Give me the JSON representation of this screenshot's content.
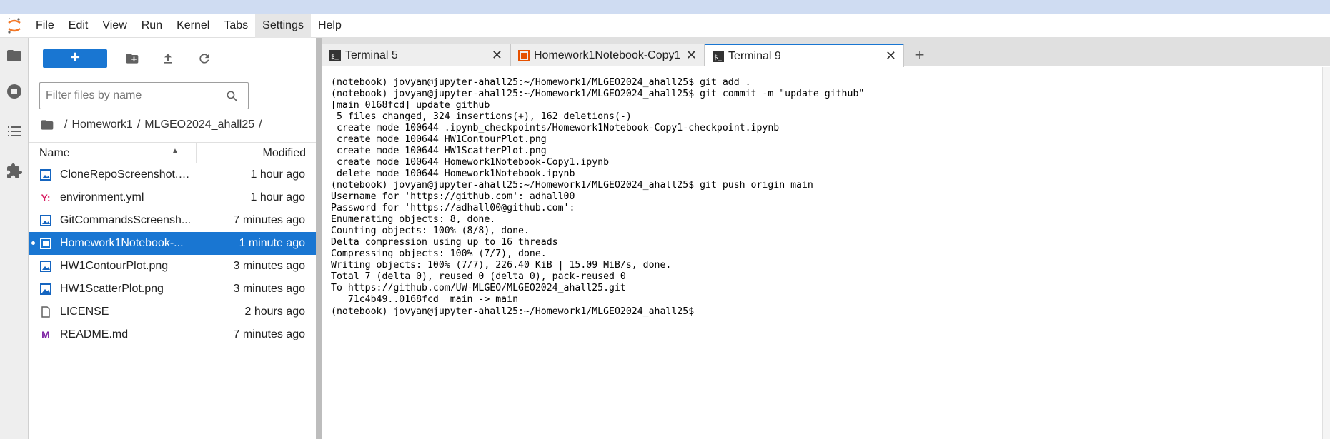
{
  "menubar": {
    "items": [
      "File",
      "Edit",
      "View",
      "Run",
      "Kernel",
      "Tabs",
      "Settings",
      "Help"
    ],
    "active_index": 6
  },
  "sidebar": {
    "tabs": [
      "folder-icon",
      "running-icon",
      "toc-icon",
      "extension-icon"
    ]
  },
  "filebrowser": {
    "new_label": "+",
    "filter_placeholder": "Filter files by name",
    "breadcrumbs": [
      "/",
      "Homework1",
      "/",
      "MLGEO2024_ahall25",
      "/"
    ],
    "header": {
      "name": "Name",
      "modified": "Modified"
    },
    "files": [
      {
        "name": "CloneRepoScreenshot.p...",
        "modified": "1 hour ago",
        "icon": "image-icon"
      },
      {
        "name": "environment.yml",
        "modified": "1 hour ago",
        "icon": "yaml-icon"
      },
      {
        "name": "GitCommandsScreensh...",
        "modified": "7 minutes ago",
        "icon": "image-icon"
      },
      {
        "name": "Homework1Notebook-...",
        "modified": "1 minute ago",
        "icon": "notebook-icon",
        "selected": true
      },
      {
        "name": "HW1ContourPlot.png",
        "modified": "3 minutes ago",
        "icon": "image-icon"
      },
      {
        "name": "HW1ScatterPlot.png",
        "modified": "3 minutes ago",
        "icon": "image-icon"
      },
      {
        "name": "LICENSE",
        "modified": "2 hours ago",
        "icon": "file-icon"
      },
      {
        "name": "README.md",
        "modified": "7 minutes ago",
        "icon": "markdown-icon"
      }
    ]
  },
  "tabs": [
    {
      "label": "Terminal 5",
      "icon": "terminal-icon"
    },
    {
      "label": "Homework1Notebook-Copy1",
      "icon": "notebook-icon"
    },
    {
      "label": "Terminal 9",
      "icon": "terminal-icon",
      "active": true
    }
  ],
  "terminal": {
    "lines": [
      "(notebook) jovyan@jupyter-ahall25:~/Homework1/MLGEO2024_ahall25$ git add .",
      "(notebook) jovyan@jupyter-ahall25:~/Homework1/MLGEO2024_ahall25$ git commit -m \"update github\"",
      "[main 0168fcd] update github",
      " 5 files changed, 324 insertions(+), 162 deletions(-)",
      " create mode 100644 .ipynb_checkpoints/Homework1Notebook-Copy1-checkpoint.ipynb",
      " create mode 100644 HW1ContourPlot.png",
      " create mode 100644 HW1ScatterPlot.png",
      " create mode 100644 Homework1Notebook-Copy1.ipynb",
      " delete mode 100644 Homework1Notebook.ipynb",
      "(notebook) jovyan@jupyter-ahall25:~/Homework1/MLGEO2024_ahall25$ git push origin main",
      "Username for 'https://github.com': adhall00",
      "Password for 'https://adhall00@github.com':",
      "Enumerating objects: 8, done.",
      "Counting objects: 100% (8/8), done.",
      "Delta compression using up to 16 threads",
      "Compressing objects: 100% (7/7), done.",
      "Writing objects: 100% (7/7), 226.40 KiB | 15.09 MiB/s, done.",
      "Total 7 (delta 0), reused 0 (delta 0), pack-reused 0",
      "To https://github.com/UW-MLGEO/MLGEO2024_ahall25.git",
      "   71c4b49..0168fcd  main -> main"
    ],
    "prompt": "(notebook) jovyan@jupyter-ahall25:~/Homework1/MLGEO2024_ahall25$ "
  },
  "colors": {
    "accent": "#1976d2",
    "logo": "#f37726",
    "markdown": "#7b1fa2",
    "yaml": "#d81b60",
    "notebook": "#e65100"
  }
}
